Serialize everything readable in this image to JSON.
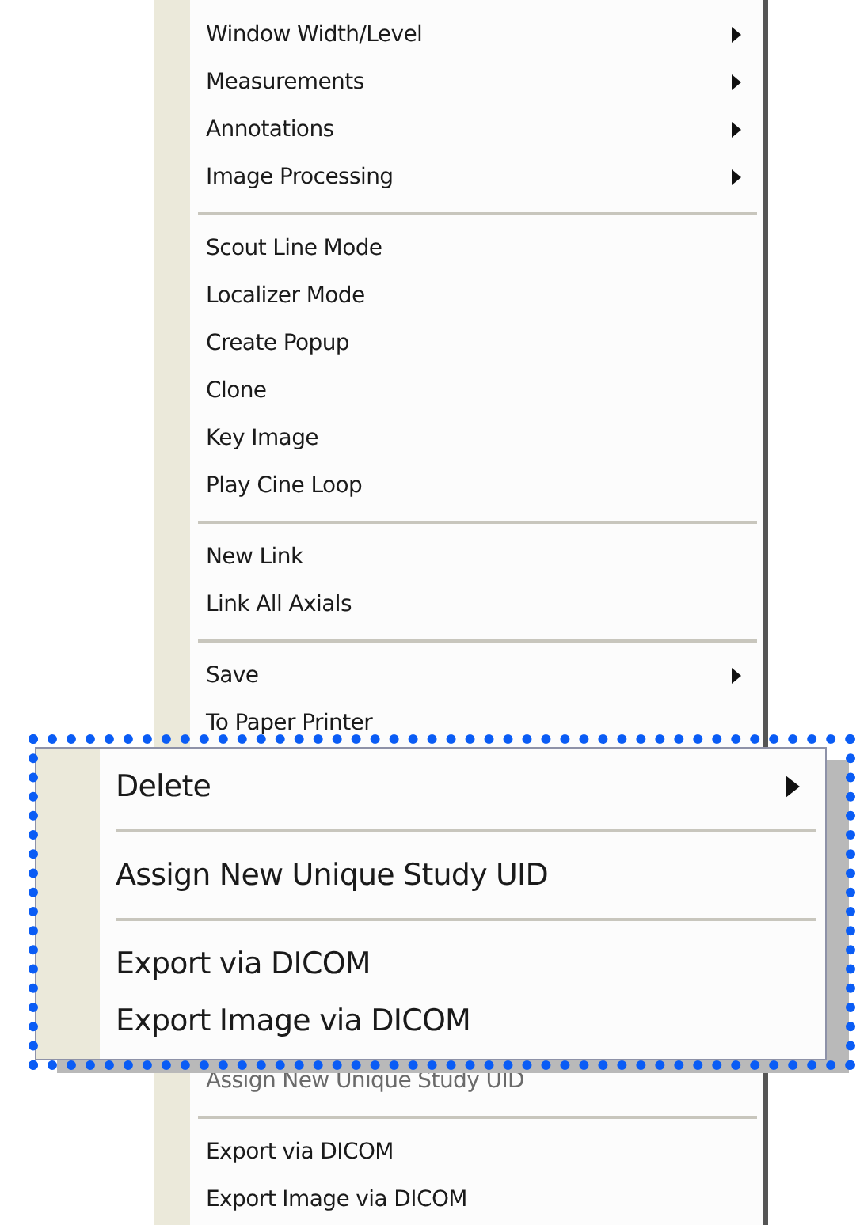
{
  "context_menu": {
    "groups": [
      {
        "items": [
          {
            "label": "Window Width/Level",
            "submenu": true
          },
          {
            "label": "Measurements",
            "submenu": true
          },
          {
            "label": "Annotations",
            "submenu": true
          },
          {
            "label": "Image Processing",
            "submenu": true
          }
        ]
      },
      {
        "items": [
          {
            "label": "Scout Line Mode",
            "submenu": false
          },
          {
            "label": "Localizer Mode",
            "submenu": false
          },
          {
            "label": "Create Popup",
            "submenu": false
          },
          {
            "label": "Clone",
            "submenu": false
          },
          {
            "label": "Key Image",
            "submenu": false
          },
          {
            "label": "Play Cine Loop",
            "submenu": false
          }
        ]
      },
      {
        "items": [
          {
            "label": "New Link",
            "submenu": false
          },
          {
            "label": "Link All Axials",
            "submenu": false
          }
        ]
      },
      {
        "items": [
          {
            "label": "Save",
            "submenu": true
          },
          {
            "label": "To Paper Printer",
            "submenu": false
          }
        ]
      },
      {
        "behind_callout": true,
        "items": [
          {
            "label": "Assign New Unique Study UID",
            "submenu": false
          }
        ]
      },
      {
        "items": [
          {
            "label": "Export via DICOM",
            "submenu": false
          },
          {
            "label": "Export Image via DICOM",
            "submenu": false
          }
        ]
      }
    ]
  },
  "zoomed_callout": {
    "groups": [
      {
        "items": [
          {
            "label": "Delete",
            "submenu": true
          }
        ]
      },
      {
        "items": [
          {
            "label": "Assign New Unique Study UID",
            "submenu": false
          }
        ]
      },
      {
        "items": [
          {
            "label": "Export via DICOM",
            "submenu": false
          },
          {
            "label": "Export Image via DICOM",
            "submenu": false
          }
        ]
      }
    ]
  }
}
